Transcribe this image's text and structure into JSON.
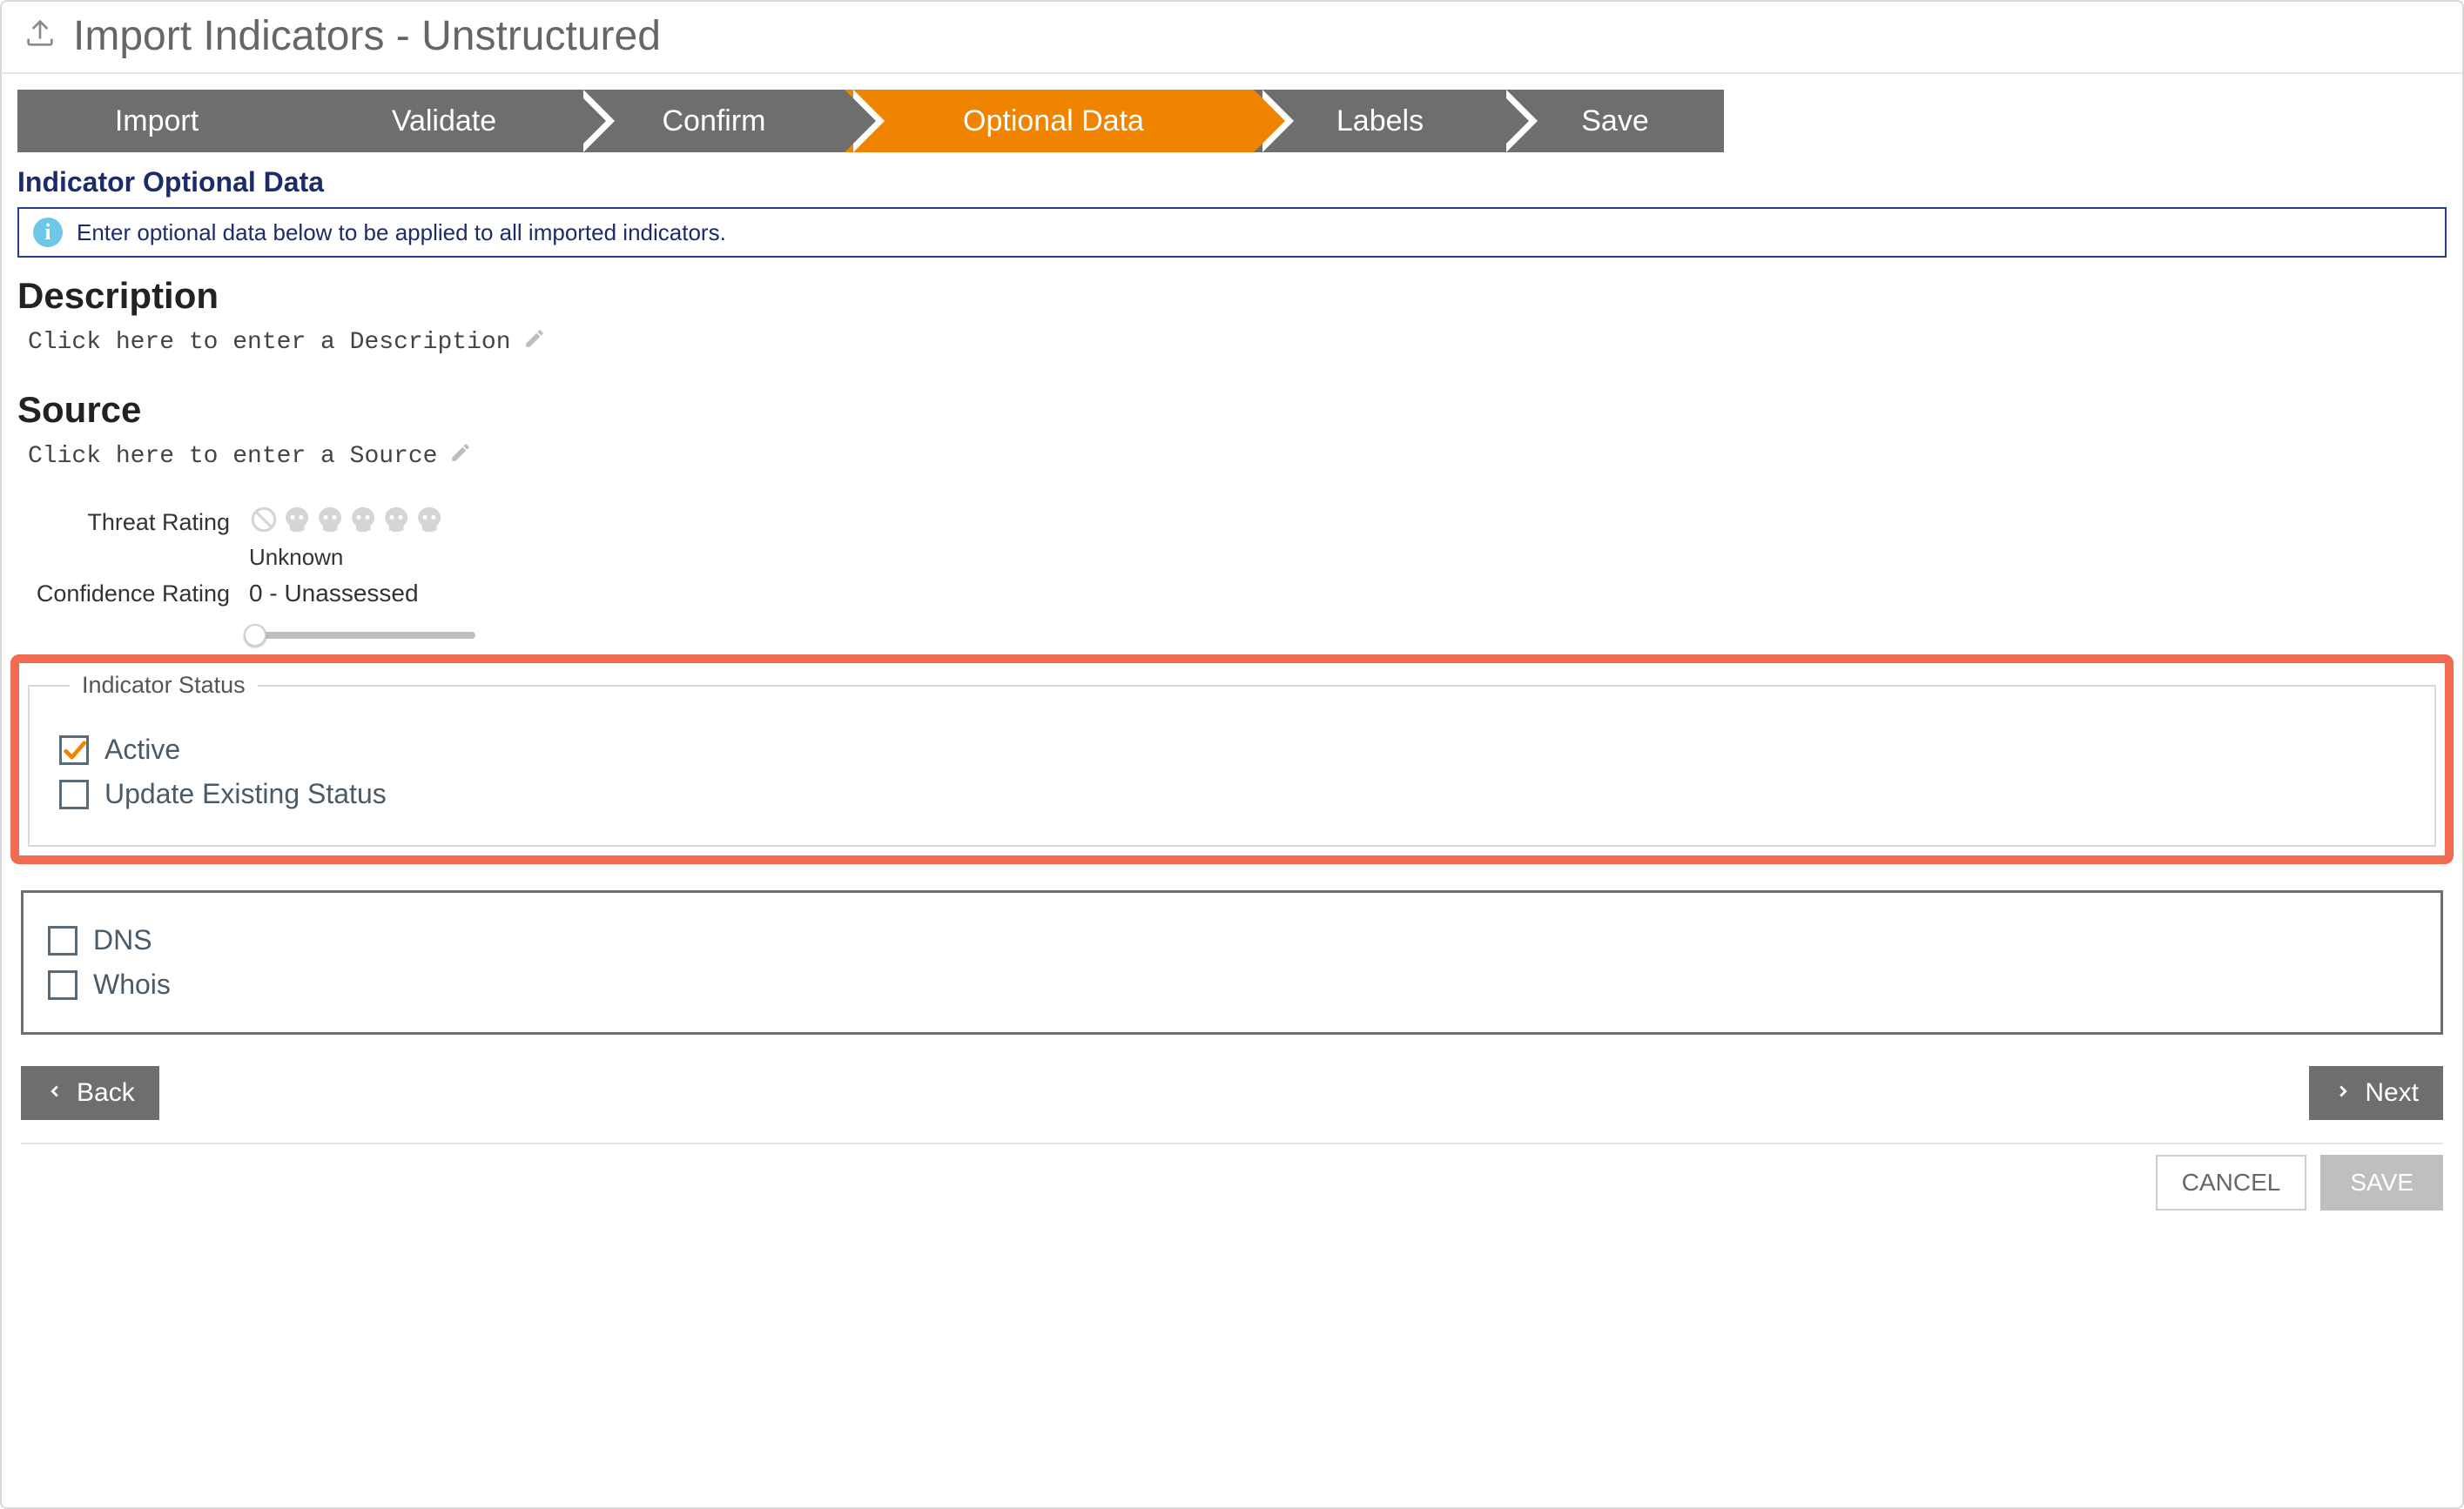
{
  "header": {
    "title": "Import Indicators - Unstructured"
  },
  "steps": {
    "import": "Import",
    "validate": "Validate",
    "confirm": "Confirm",
    "optional": "Optional Data",
    "labels": "Labels",
    "save": "Save",
    "active": "optional"
  },
  "section": {
    "title": "Indicator Optional Data"
  },
  "info": {
    "text": "Enter optional data below to be applied to all imported indicators."
  },
  "description": {
    "heading": "Description",
    "placeholder": "Click here to enter a Description"
  },
  "source": {
    "heading": "Source",
    "placeholder": "Click here to enter a Source"
  },
  "ratings": {
    "threat_label": "Threat Rating",
    "threat_value": "Unknown",
    "confidence_label": "Confidence Rating",
    "confidence_value": "0 - Unassessed"
  },
  "status": {
    "legend": "Indicator Status",
    "active_label": "Active",
    "active_checked": true,
    "update_label": "Update Existing Status",
    "update_checked": false
  },
  "enrichment": {
    "dns_label": "DNS",
    "dns_checked": false,
    "whois_label": "Whois",
    "whois_checked": false
  },
  "nav": {
    "back": "Back",
    "next": "Next"
  },
  "footer": {
    "cancel": "CANCEL",
    "save": "SAVE"
  }
}
